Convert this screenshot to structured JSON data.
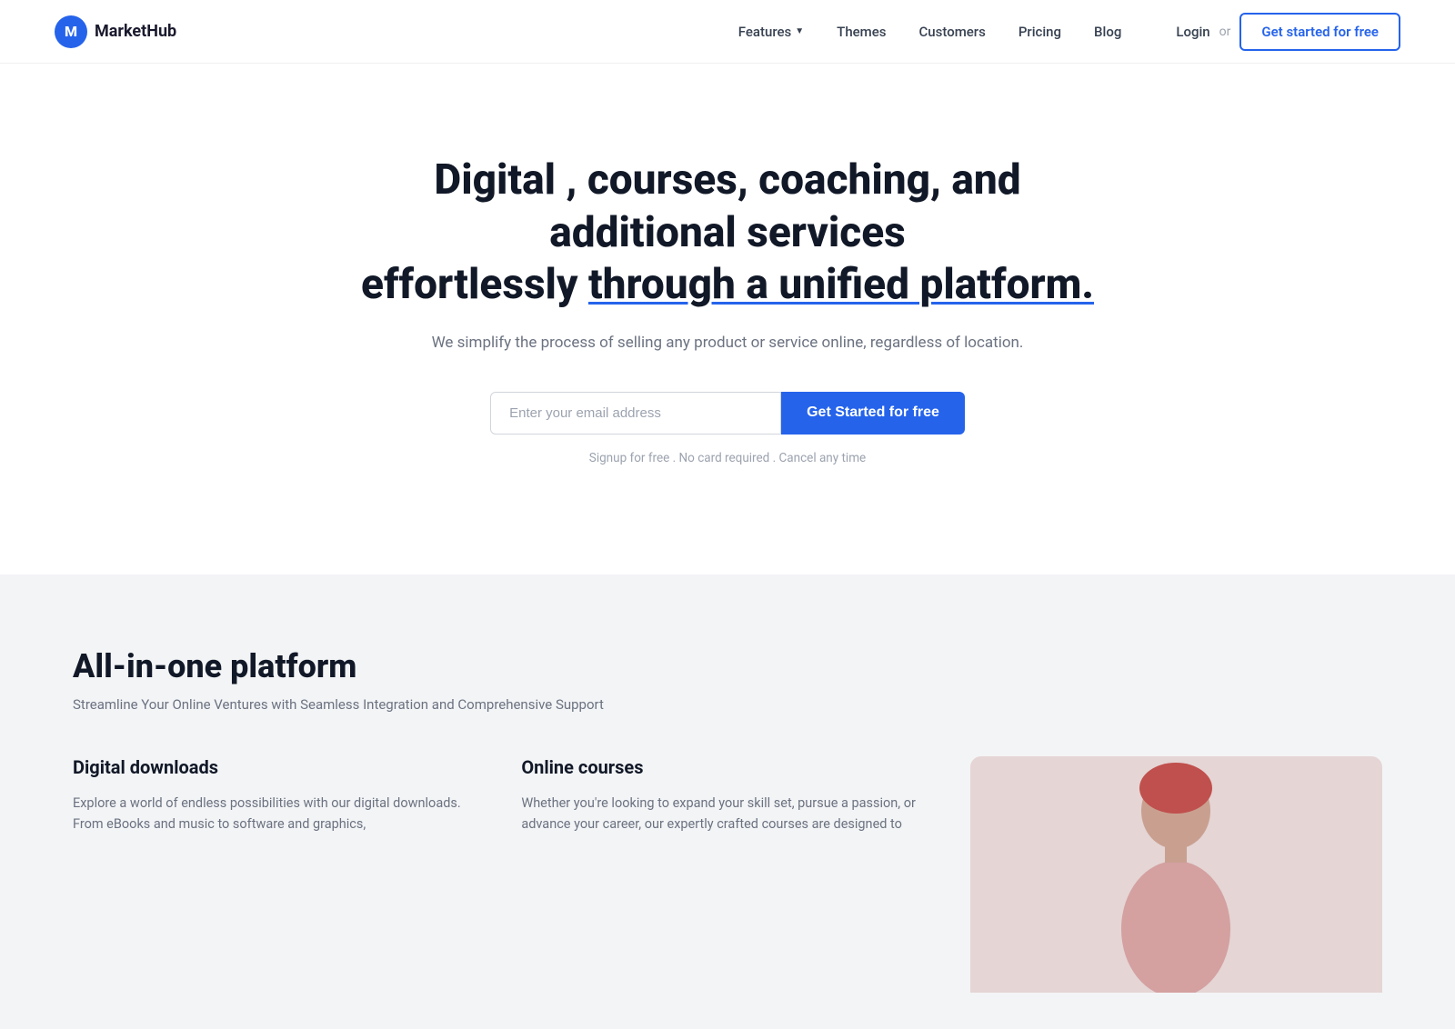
{
  "brand": {
    "logo_letter": "M",
    "name": "MarketHub"
  },
  "nav": {
    "links": [
      {
        "label": "Features",
        "has_dropdown": true
      },
      {
        "label": "Themes",
        "has_dropdown": false
      },
      {
        "label": "Customers",
        "has_dropdown": false
      },
      {
        "label": "Pricing",
        "has_dropdown": false
      },
      {
        "label": "Blog",
        "has_dropdown": false
      }
    ],
    "login_label": "Login",
    "or_label": "or",
    "cta_label": "Get started for free"
  },
  "hero": {
    "title_line1": "Digital , courses, coaching, and additional services",
    "title_line2_plain": "effortlessly ",
    "title_line2_underlined": "through a unified platform.",
    "subtitle": "We simplify the process of selling any product or service online, regardless of location.",
    "email_placeholder": "Enter your email address",
    "cta_label": "Get Started for free",
    "fine_print": "Signup for free .  No card required .  Cancel any time"
  },
  "features": {
    "section_title": "All-in-one platform",
    "section_subtitle": "Streamline Your Online Ventures with Seamless Integration and Comprehensive Support",
    "cards": [
      {
        "title": "Digital downloads",
        "text": "Explore a world of endless possibilities with our digital downloads. From eBooks and music to software and graphics,"
      },
      {
        "title": "Online courses",
        "text": "Whether you're looking to expand your skill set, pursue a passion, or advance your career, our expertly crafted courses are designed to"
      }
    ]
  }
}
